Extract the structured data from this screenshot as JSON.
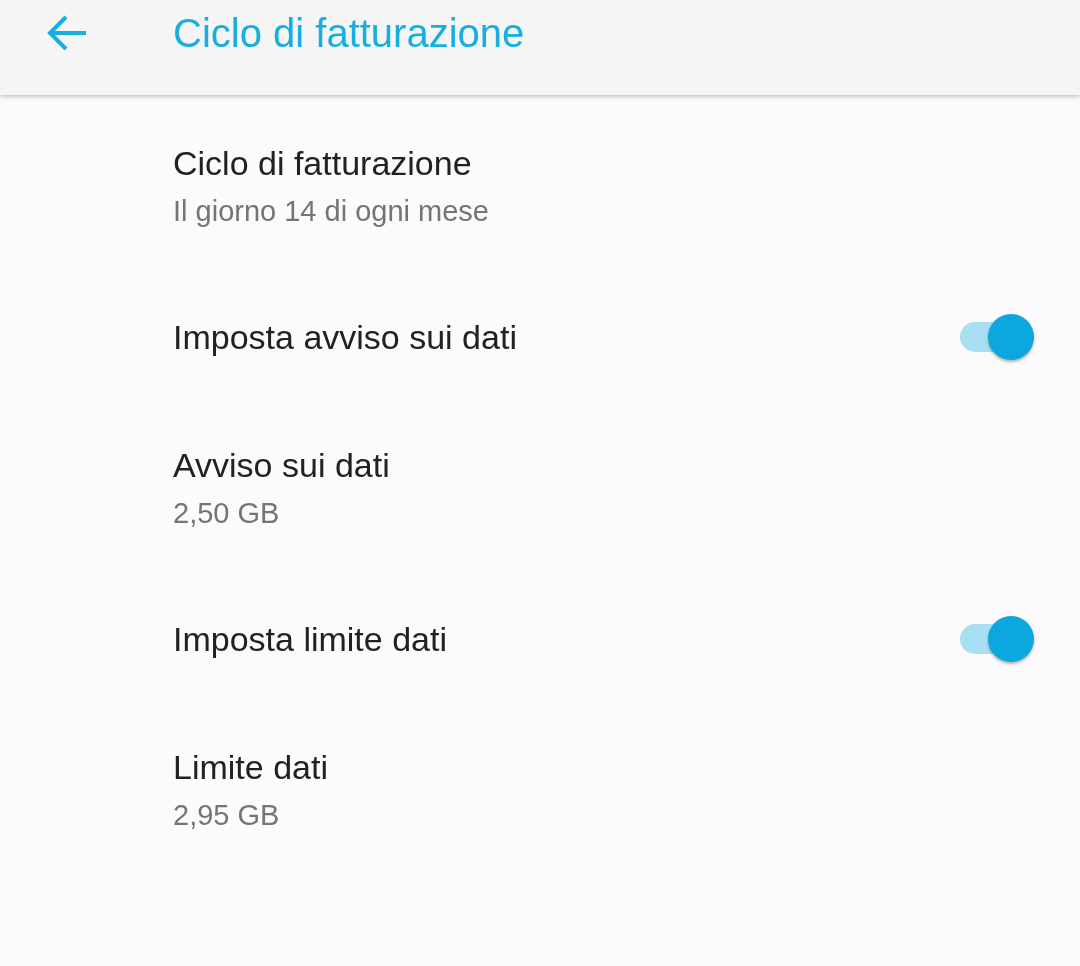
{
  "app_bar": {
    "title": "Ciclo di fatturazione"
  },
  "items": [
    {
      "kind": "text",
      "title": "Ciclo di fatturazione",
      "summary": "Il giorno 14 di ogni mese"
    },
    {
      "kind": "switch",
      "title": "Imposta avviso sui dati",
      "on": true
    },
    {
      "kind": "text",
      "title": "Avviso sui dati",
      "summary": "2,50 GB"
    },
    {
      "kind": "switch",
      "title": "Imposta limite dati",
      "on": true
    },
    {
      "kind": "text",
      "title": "Limite dati",
      "summary": "2,95 GB"
    }
  ]
}
